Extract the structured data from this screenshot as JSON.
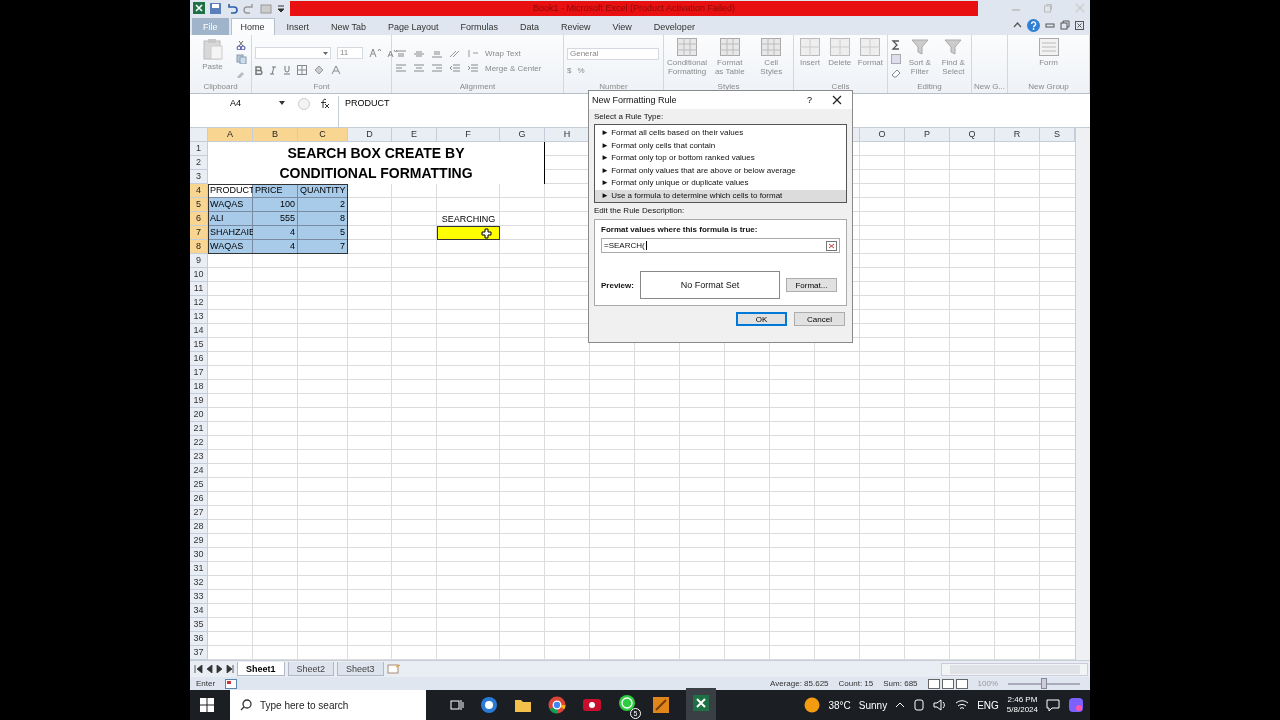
{
  "window": {
    "title": "Book1  -  Microsoft Excel (Product Activation Failed)"
  },
  "ribbon_tabs": [
    {
      "label": "File",
      "selected": false,
      "kind": "file"
    },
    {
      "label": "Home",
      "selected": true,
      "kind": "tab"
    },
    {
      "label": "Insert",
      "selected": false,
      "kind": "tab"
    },
    {
      "label": "New Tab",
      "selected": false,
      "kind": "tab"
    },
    {
      "label": "Page Layout",
      "selected": false,
      "kind": "tab"
    },
    {
      "label": "Formulas",
      "selected": false,
      "kind": "tab"
    },
    {
      "label": "Data",
      "selected": false,
      "kind": "tab"
    },
    {
      "label": "Review",
      "selected": false,
      "kind": "tab"
    },
    {
      "label": "View",
      "selected": false,
      "kind": "tab"
    },
    {
      "label": "Developer",
      "selected": false,
      "kind": "tab"
    }
  ],
  "ribbon": {
    "disabled": true,
    "clipboard": {
      "label": "Clipboard",
      "paste": "Paste"
    },
    "font": {
      "label": "Font",
      "size": "11"
    },
    "alignment": {
      "label": "Alignment",
      "wrap_text": "Wrap Text",
      "merge_center": "Merge & Center"
    },
    "number": {
      "label": "Number",
      "format": "General",
      "currency": "$",
      "percent": "%"
    },
    "styles": {
      "label": "Styles",
      "buttons": [
        "Conditional Formatting",
        "Format as Table",
        "Cell Styles"
      ]
    },
    "cells": {
      "label": "Cells",
      "buttons": [
        "Insert",
        "Delete",
        "Format"
      ]
    },
    "editing": {
      "label": "Editing",
      "buttons": [
        "Sort & Filter",
        "Find & Select"
      ]
    },
    "new_g": {
      "label": "New G..."
    },
    "new_group": {
      "label": "New Group",
      "buttons": [
        "Form"
      ]
    }
  },
  "formula_bar": {
    "name_box": "A4",
    "formula": "PRODUCT"
  },
  "sheet": {
    "columns_left": [
      {
        "label": "A",
        "selected": true
      },
      {
        "label": "B",
        "selected": true
      },
      {
        "label": "C",
        "selected": true
      },
      {
        "label": "D",
        "selected": false
      },
      {
        "label": "E",
        "selected": false
      },
      {
        "label": "F",
        "selected": false
      },
      {
        "label": "G",
        "selected": false
      },
      {
        "label": "H",
        "selected": false
      }
    ],
    "columns_right": [
      {
        "label": "O",
        "selected": false
      },
      {
        "label": "P",
        "selected": false
      },
      {
        "label": "Q",
        "selected": false
      },
      {
        "label": "R",
        "selected": false
      },
      {
        "label": "S",
        "selected": false
      }
    ],
    "rows": [
      {
        "label": "1",
        "selected": false
      },
      {
        "label": "2",
        "selected": false
      },
      {
        "label": "3",
        "selected": false
      },
      {
        "label": "4",
        "selected": true
      },
      {
        "label": "5",
        "selected": true
      },
      {
        "label": "6",
        "selected": true
      },
      {
        "label": "7",
        "selected": true
      },
      {
        "label": "8",
        "selected": true
      },
      {
        "label": "9",
        "selected": false
      },
      {
        "label": "10",
        "selected": false
      },
      {
        "label": "11",
        "selected": false
      },
      {
        "label": "12",
        "selected": false
      },
      {
        "label": "13",
        "selected": false
      },
      {
        "label": "14",
        "selected": false
      },
      {
        "label": "15",
        "selected": false
      },
      {
        "label": "16",
        "selected": false
      },
      {
        "label": "17",
        "selected": false
      },
      {
        "label": "18",
        "selected": false
      },
      {
        "label": "19",
        "selected": false
      },
      {
        "label": "20",
        "selected": false
      },
      {
        "label": "21",
        "selected": false
      },
      {
        "label": "22",
        "selected": false
      },
      {
        "label": "23",
        "selected": false
      },
      {
        "label": "24",
        "selected": false
      },
      {
        "label": "25",
        "selected": false
      },
      {
        "label": "26",
        "selected": false
      },
      {
        "label": "27",
        "selected": false
      },
      {
        "label": "28",
        "selected": false
      },
      {
        "label": "29",
        "selected": false
      },
      {
        "label": "30",
        "selected": false
      },
      {
        "label": "31",
        "selected": false
      },
      {
        "label": "32",
        "selected": false
      },
      {
        "label": "33",
        "selected": false
      },
      {
        "label": "34",
        "selected": false
      },
      {
        "label": "35",
        "selected": false
      },
      {
        "label": "36",
        "selected": false
      },
      {
        "label": "37",
        "selected": false
      }
    ],
    "title_lines": [
      "SEARCH BOX CREATE BY",
      "CONDITIONAL FORMATTING"
    ],
    "table": {
      "header": [
        "PRODUCT",
        "PRICE",
        "QUANTITY"
      ],
      "rows": [
        [
          "WAQAS",
          "100",
          "2"
        ],
        [
          "ALI",
          "555",
          "8"
        ],
        [
          "SHAHZAIB",
          "4",
          "5"
        ],
        [
          "WAQAS",
          "4",
          "7"
        ]
      ]
    },
    "search_label": "SEARCHING"
  },
  "sheet_tabs": [
    {
      "label": "Sheet1",
      "selected": true
    },
    {
      "label": "Sheet2",
      "selected": false
    },
    {
      "label": "Sheet3",
      "selected": false
    }
  ],
  "status_bar": {
    "mode": "Enter",
    "average": "Average: 85.625",
    "count": "Count: 15",
    "sum": "Sum: 685",
    "zoom": "100%",
    "zoom_slider": {
      "level": 0.5
    }
  },
  "dialog": {
    "title": "New Formatting Rule",
    "help": "?",
    "select_label": "Select a Rule Type:",
    "rule_types": [
      {
        "label": "► Format all cells based on their values",
        "selected": false
      },
      {
        "label": "► Format only cells that contain",
        "selected": false
      },
      {
        "label": "► Format only top or bottom ranked values",
        "selected": false
      },
      {
        "label": "► Format only values that are above or below average",
        "selected": false
      },
      {
        "label": "► Format only unique or duplicate values",
        "selected": false
      },
      {
        "label": "► Use a formula to determine which cells to format",
        "selected": true
      }
    ],
    "edit_label": "Edit the Rule Description:",
    "formula_label": "Format values where this formula is true:",
    "formula": "=SEARCH(",
    "preview_label": "Preview:",
    "preview": "No Format Set",
    "format_button": "Format...",
    "ok": "OK",
    "cancel": "Cancel"
  },
  "taskbar": {
    "search_placeholder": "Type here to search",
    "whatsapp_badge": "5",
    "temperature": "38°C",
    "weather": "Sunny",
    "language": "ENG",
    "time": "2:46 PM",
    "date": "5/8/2024"
  }
}
